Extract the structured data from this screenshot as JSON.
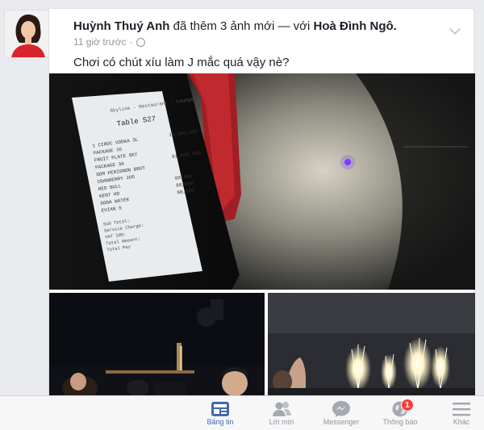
{
  "post": {
    "author": "Huỳnh Thuý Anh",
    "action": "đã thêm 3 ảnh mới — với",
    "with": "Hoà Đình Ngô.",
    "time": "11 giờ trước",
    "separator": "·",
    "caption": "Chơi có chút xíu làm J mắc quá vậy nè?"
  },
  "receipt": {
    "header": "Skyline - Restaurant - Lounge",
    "table": "Table  S27",
    "lines": [
      "1 CIROC VODKA 3L",
      "PACKAGE 1G",
      "FRUIT PLATE SKY",
      "PACKAGE 3A",
      "DOM PERIGNON BRUT",
      "CRANBERRY JUG",
      "RED BULL",
      "KENT HD",
      "SODA WATER",
      "EVIAN S"
    ],
    "amounts": [
      "10,600,000",
      "",
      "",
      "61,800,000",
      "",
      "",
      "80,000",
      "80,000",
      "90,000",
      ""
    ],
    "footer": [
      "Sub Total:",
      "Service Charge:",
      "VAT 10%:",
      "Total Amount:",
      "Total Pay"
    ]
  },
  "tabbar": {
    "items": [
      {
        "label": "Bảng tin",
        "icon": "news-feed-icon",
        "active": true
      },
      {
        "label": "Lời mời",
        "icon": "friend-requests-icon",
        "active": false
      },
      {
        "label": "Messenger",
        "icon": "messenger-icon",
        "active": false
      },
      {
        "label": "Thông báo",
        "icon": "notifications-globe-icon",
        "active": false,
        "badge": "1"
      },
      {
        "label": "Khác",
        "icon": "more-menu-icon",
        "active": false
      }
    ]
  },
  "colors": {
    "accent": "#4267b2",
    "badge": "#fa3e3e",
    "text": "#1d2129",
    "muted": "#90949c"
  }
}
